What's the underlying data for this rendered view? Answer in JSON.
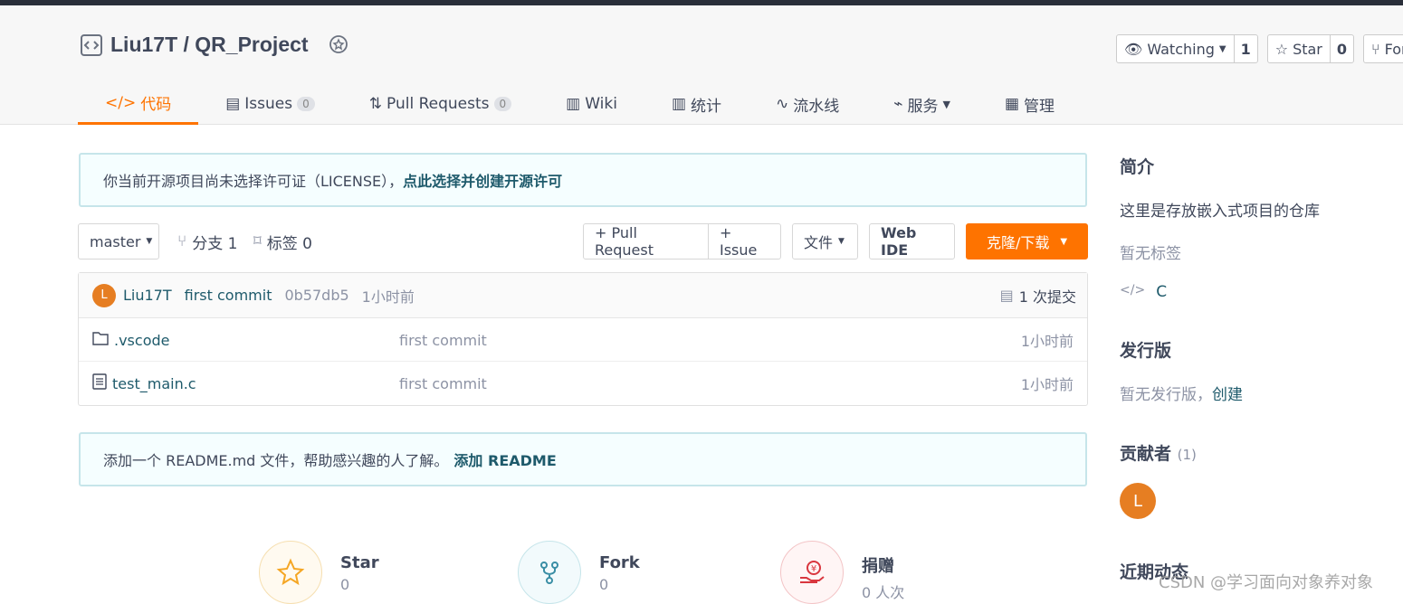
{
  "repo": {
    "owner": "Liu17T",
    "name": "QR_Project",
    "title": "Liu17T / QR_Project"
  },
  "actions": {
    "watch": {
      "label": "Watching",
      "count": "1"
    },
    "star": {
      "label": "Star",
      "count": "0"
    },
    "fork": {
      "label": "Fork"
    }
  },
  "tabs": [
    {
      "label": "代码",
      "active": true
    },
    {
      "label": "Issues",
      "badge": "0"
    },
    {
      "label": "Pull Requests",
      "badge": "0"
    },
    {
      "label": "Wiki"
    },
    {
      "label": "统计"
    },
    {
      "label": "流水线"
    },
    {
      "label": "服务"
    },
    {
      "label": "管理"
    }
  ],
  "license_notice": {
    "text": "你当前开源项目尚未选择许可证（LICENSE），",
    "link": "点此选择并创建开源许可"
  },
  "branch_bar": {
    "branch": "master",
    "branches": "分支 1",
    "tags": "标签 0",
    "pull_request": "+ Pull Request",
    "issue": "+ Issue",
    "file": "文件",
    "web_ide": "Web IDE",
    "clone": "克隆/下载"
  },
  "last_commit": {
    "avatar": "L",
    "author": "Liu17T",
    "message": "first commit",
    "hash": "0b57db5",
    "time": "1小时前",
    "commits": "1 次提交"
  },
  "files": [
    {
      "name": ".vscode",
      "type": "folder",
      "message": "first commit",
      "time": "1小时前"
    },
    {
      "name": "test_main.c",
      "type": "file",
      "message": "first commit",
      "time": "1小时前"
    }
  ],
  "readme_notice": {
    "text": "添加一个 README.md 文件，帮助感兴趣的人了解。",
    "link": "添加 README"
  },
  "stats": [
    {
      "title": "Star",
      "value": "0",
      "color": "#f5a623"
    },
    {
      "title": "Fork",
      "value": "0",
      "color": "#3a8ea5"
    },
    {
      "title": "捐赠",
      "value": "0 人次",
      "color": "#d9363e"
    }
  ],
  "sidebar": {
    "intro_title": "简介",
    "intro_text": "这里是存放嵌入式项目的仓库",
    "no_tags": "暂无标签",
    "language": "C",
    "release_title": "发行版",
    "release_none": "暂无发行版，",
    "release_create": "创建",
    "contributors_title": "贡献者",
    "contributors_count": "(1)",
    "contributor_avatar": "L",
    "recent_title": "近期动态"
  },
  "watermark": "CSDN @学习面向对象养对象"
}
